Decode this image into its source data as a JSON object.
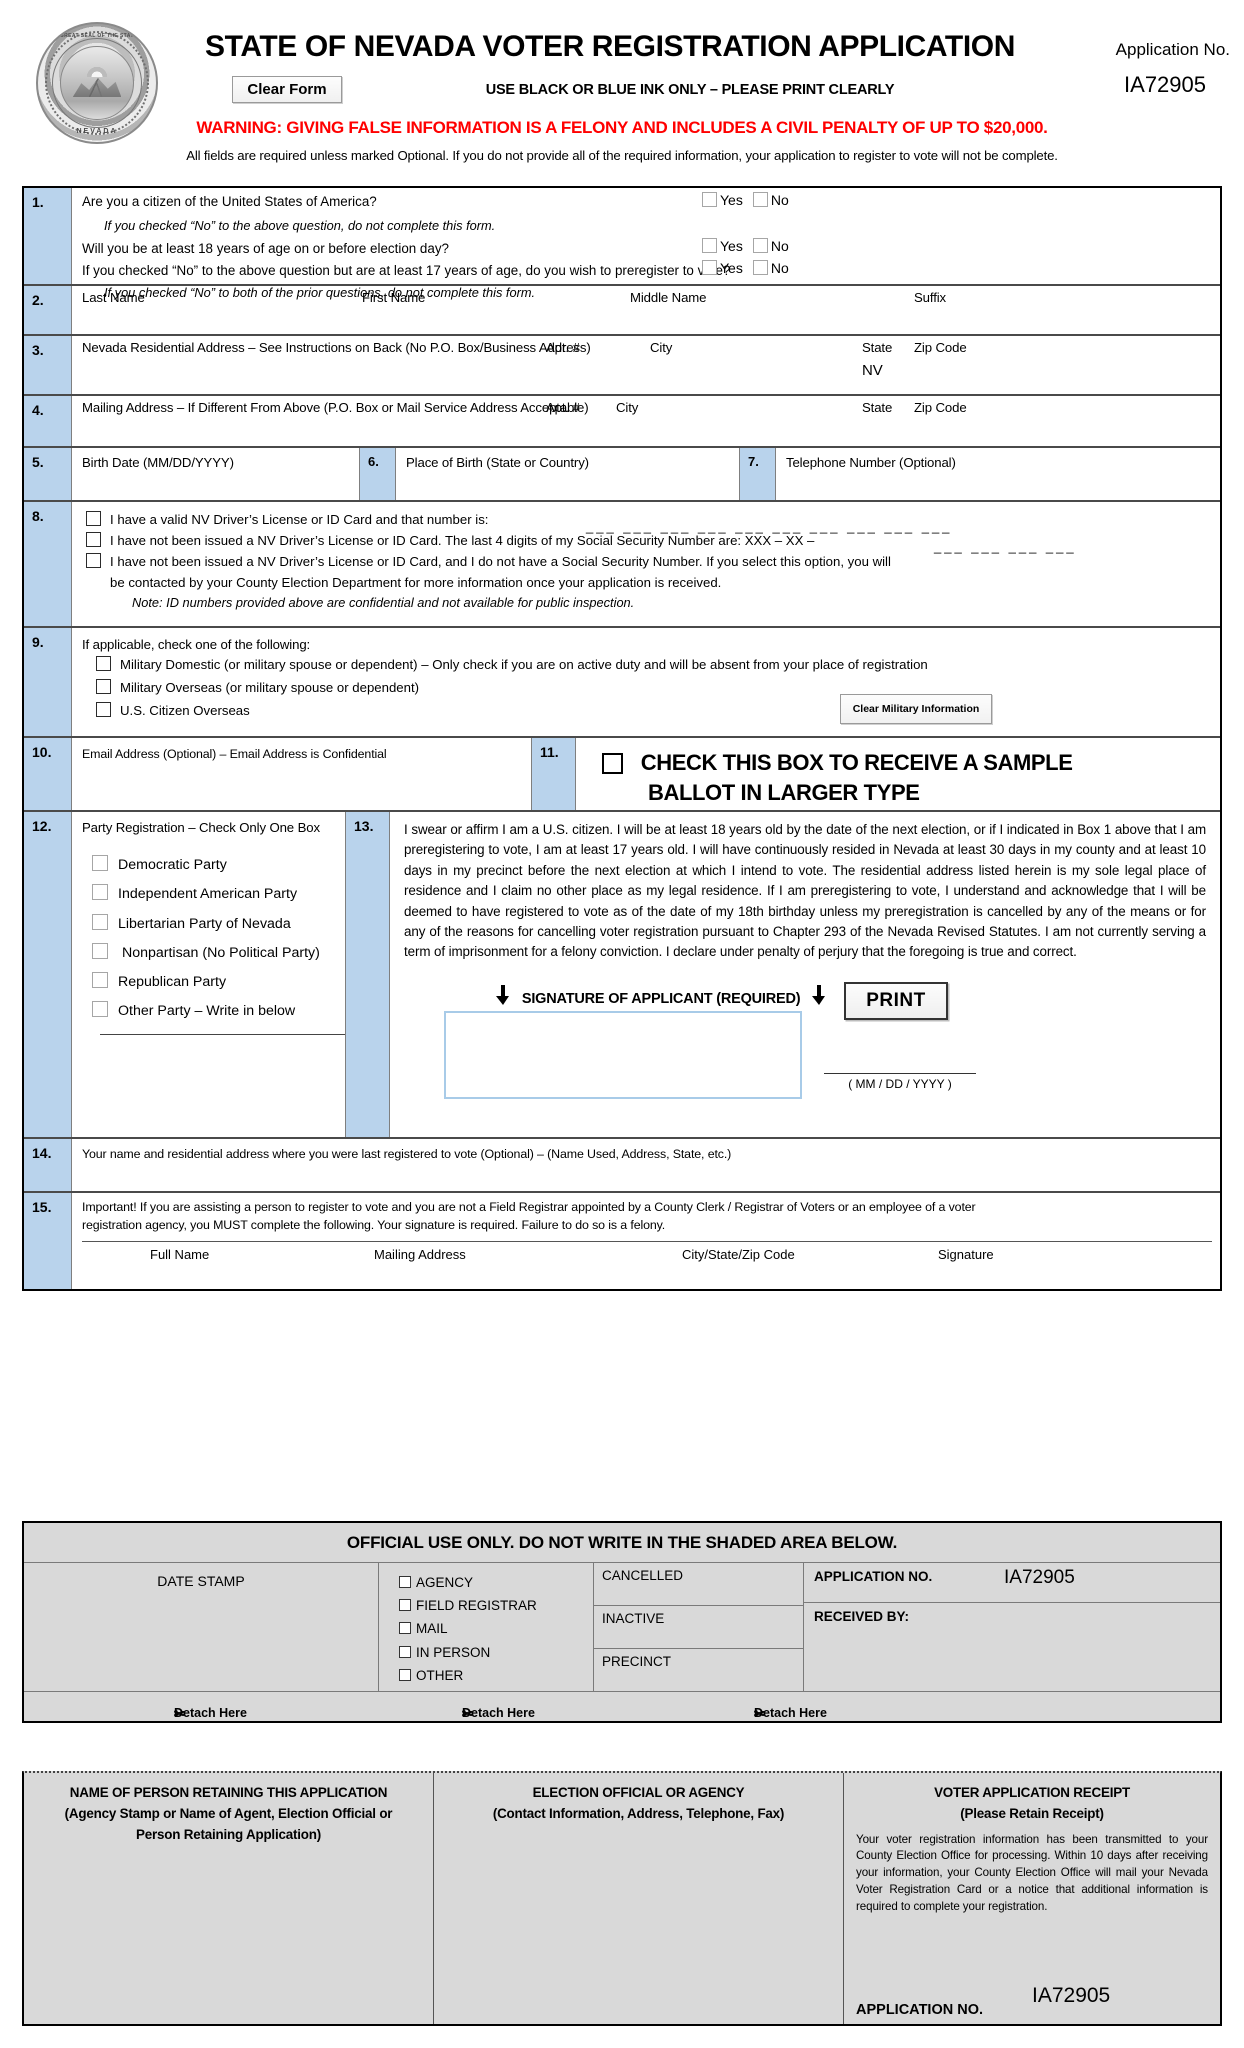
{
  "header": {
    "title": "STATE OF NEVADA VOTER REGISTRATION APPLICATION",
    "clear_form_label": "Clear Form",
    "ink_instruction": "USE BLACK OR BLUE INK ONLY – PLEASE PRINT CLEARLY",
    "application_no_label": "Application No.",
    "application_no_value": "IA72905",
    "warning": "WARNING: GIVING FALSE INFORMATION IS A FELONY AND INCLUDES A CIVIL PENALTY OF UP TO $20,000.",
    "all_fields_note": "All fields are required unless marked Optional. If you do not provide all of the required information, your application to register to vote will not be complete.",
    "seal_top_text": "THE GREAT SEAL OF THE STATE OF",
    "seal_bottom_text": "NEVADA"
  },
  "yes_label": "Yes",
  "no_label": "No",
  "sections": {
    "s1": {
      "num": "1.",
      "q1": "Are you a citizen of the United States of America?",
      "note1": "If you checked “No” to the above question, do not complete this form.",
      "q2": "Will you be at least 18 years of age on or before election day?",
      "q3": "If you checked “No” to the above question but are at least 17 years of age, do you wish to preregister to vote?",
      "note2": "If you checked “No” to both of the prior questions, do not complete this form."
    },
    "s2": {
      "num": "2.",
      "last_name": "Last Name",
      "first_name": "First Name",
      "middle_name": "Middle Name",
      "suffix": "Suffix"
    },
    "s3": {
      "num": "3.",
      "address": "Nevada Residential Address – See Instructions on Back (No P.O. Box/Business Address)",
      "apt": "Apt. #",
      "city": "City",
      "state": "State",
      "zip": "Zip Code",
      "state_value": "NV"
    },
    "s4": {
      "num": "4.",
      "address": "Mailing Address – If Different From Above (P.O. Box or Mail Service Address Acceptable)",
      "apt": "Apt. #",
      "city": "City",
      "state": "State",
      "zip": "Zip Code"
    },
    "s5": {
      "num": "5.",
      "label": "Birth Date (MM/DD/YYYY)"
    },
    "s6": {
      "num": "6.",
      "label": "Place of Birth (State or Country)"
    },
    "s7": {
      "num": "7.",
      "label": "Telephone Number (Optional)"
    },
    "s8": {
      "num": "8.",
      "opt1": "I have a valid NV Driver’s License or ID Card and that number is:",
      "opt2": "I have not been issued a NV Driver’s License or ID Card.  The last 4 digits of my Social Security Number are: XXX – XX –",
      "opt3_l1": "I have not been issued a NV Driver’s License or ID Card, and I do not have a Social Security Number.  If you select this option, you will",
      "opt3_l2": "be contacted by your County Election Department for more information once your application is received.",
      "note": "Note: ID numbers provided above are confidential and not available for public inspection."
    },
    "s9": {
      "num": "9.",
      "heading": "If applicable, check one of the following:",
      "opt1": "Military Domestic (or military spouse or dependent) – Only check if you are on active duty and will be absent from your place of registration",
      "opt2": "Military Overseas (or military spouse or dependent)",
      "opt3": "U.S. Citizen Overseas",
      "clear_military_label": "Clear Military Information"
    },
    "s10": {
      "num": "10.",
      "label": "Email Address (Optional) – Email Address is Confidential"
    },
    "s11": {
      "num": "11.",
      "line1": "CHECK THIS BOX TO RECEIVE A SAMPLE",
      "line2": "BALLOT IN LARGER TYPE"
    },
    "s12": {
      "num": "12.",
      "heading": "Party Registration – Check Only One Box",
      "parties": [
        "Democratic Party",
        "Independent American Party",
        "Libertarian Party of Nevada",
        " Nonpartisan (No Political Party)",
        "Republican Party",
        "Other Party – Write in below"
      ]
    },
    "s13": {
      "num": "13.",
      "oath": "I swear or affirm I am a U.S. citizen.  I will be at least 18 years old by the date of the next election, or if I indicated in Box 1 above that I am preregistering to vote, I am at least 17 years old.  I will have continuously resided in Nevada at least 30 days in my county and at least 10 days in my precinct before the next election at which I intend to vote.  The residential address listed herein is my sole legal place of residence and I claim no other place as my legal residence.  If I am preregistering to vote, I understand and acknowledge that I will be deemed to have registered to vote as of the date of my 18th birthday unless my preregistration is cancelled by any of the means or for any of the reasons for cancelling voter registration pursuant to Chapter 293 of the Nevada Revised Statutes.  I am not currently serving a term of imprisonment for a felony conviction.   I declare under penalty of perjury that the foregoing is true and correct.",
      "signature_caption": "SIGNATURE OF APPLICANT (REQUIRED)",
      "print_label": "PRINT",
      "date_hint": "( MM / DD / YYYY )"
    },
    "s14": {
      "num": "14.",
      "label": "Your name and residential address where you were last registered to vote (Optional) – (Name Used, Address, State, etc.)"
    },
    "s15": {
      "num": "15.",
      "line1": "Important!  If you are assisting a person to register to vote and you are not a Field Registrar appointed by a County Clerk / Registrar of Voters or an employee of a voter",
      "line2": "registration agency, you MUST complete the following.  Your signature is required.  Failure to do so is a felony.",
      "col1": "Full Name",
      "col2": "Mailing Address",
      "col3": "City/State/Zip Code",
      "col4": "Signature"
    }
  },
  "official": {
    "title": "OFFICIAL USE ONLY.  DO NOT WRITE IN THE SHADED AREA BELOW.",
    "date_stamp": "DATE STAMP",
    "methods": [
      "AGENCY",
      "FIELD REGISTRAR",
      "MAIL",
      "IN PERSON",
      "OTHER"
    ],
    "cancelled": "CANCELLED",
    "inactive": "INACTIVE",
    "precinct": "PRECINCT",
    "application_no_label": "APPLICATION NO.",
    "application_no_value": "IA72905",
    "received_by": "RECEIVED BY:",
    "detach_label": "Detach Here"
  },
  "receipt": {
    "col1_line1": "NAME OF PERSON RETAINING THIS APPLICATION",
    "col1_line2": "(Agency Stamp or Name of Agent, Election Official or",
    "col1_line3": "Person Retaining Application)",
    "col2_line1": "ELECTION OFFICIAL OR AGENCY",
    "col2_line2": "(Contact Information, Address, Telephone, Fax)",
    "col3_line1": "VOTER APPLICATION RECEIPT",
    "col3_line2": "(Please Retain Receipt)",
    "col3_body": "Your voter registration information has been transmitted to your County Election Office for processing.  Within 10 days after receiving your information, your County Election Office will mail your Nevada Voter Registration Card or a notice that additional information is required to complete your registration.",
    "application_no_label": "APPLICATION NO.",
    "application_no_value": "IA72905"
  }
}
